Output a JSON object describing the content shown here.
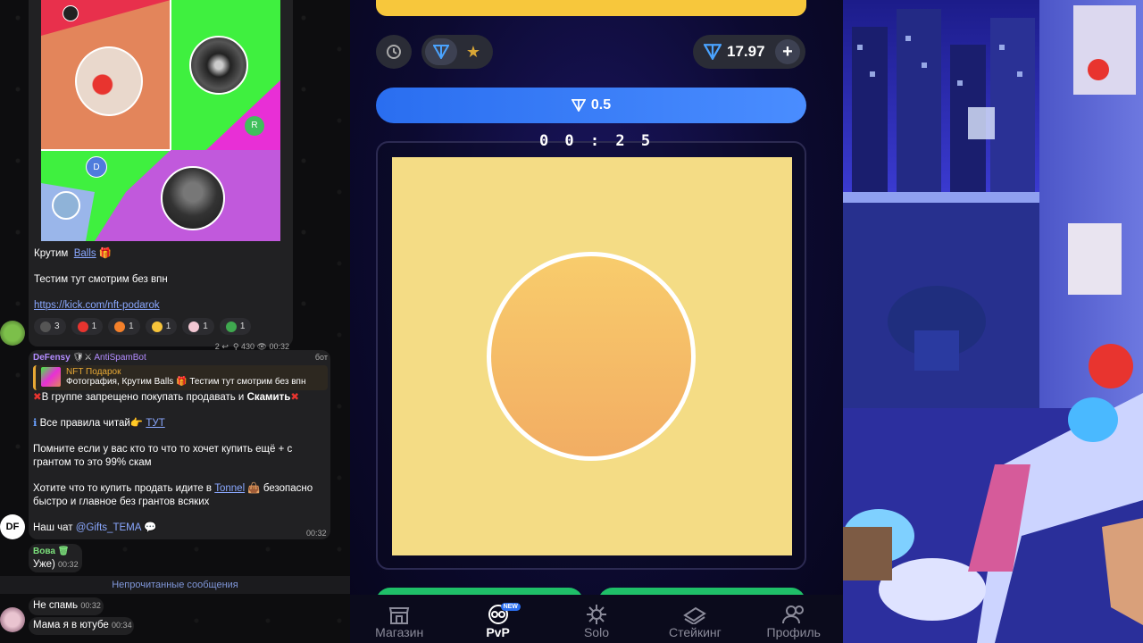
{
  "chat": {
    "post": {
      "collage_badges": [
        "R",
        "D"
      ],
      "line1": "Крутим",
      "line1_link": "Balls",
      "line2": "Тестим тут смотрим без впн",
      "url": "https://kick.com/nft-podarok",
      "reactions": [
        {
          "icon": "user-stack-icon",
          "count": "3"
        },
        {
          "icon": "heart-gift-icon",
          "count": "1"
        },
        {
          "icon": "fire-icon",
          "count": "1"
        },
        {
          "icon": "heart-eyes-icon",
          "count": "1"
        },
        {
          "icon": "gift-pink-icon",
          "count": "1"
        },
        {
          "icon": "plant-gift-icon",
          "count": "1"
        }
      ],
      "replies": "2",
      "views": "430",
      "time": "00:32"
    },
    "bot_message": {
      "author": "DeFensy",
      "author2": "AntiSpamBot",
      "bot_tag": "бот",
      "quote_title": "NFT Подарок",
      "quote_text": "Фотография, Крутим Balls",
      "quote_text2": "Тестим тут смотрим без впн",
      "rule_a": "В группе запрещено покупать продавать и",
      "rule_a_bold": "Скамить",
      "rule_b": "Все правила читай",
      "rule_b_link": "ТУТ",
      "para1": "Помните если у вас кто то что то хочет купить ещё + с грантом то это 99% скам",
      "para2_a": "Хотите что то купить продать идите в",
      "para2_link": "Tonnel",
      "para2_b": "безопасно быстро и главное без грантов всяких",
      "para3": "Наш чат",
      "para3_link": "@Gifts_TEMA",
      "time": "00:32",
      "avatar_text": "DF"
    },
    "vova": {
      "name": "Вова",
      "text": "Уже)",
      "time": "00:32"
    },
    "unread_label": "Непрочитанные сообщения",
    "msg1": {
      "text": "Не спамь",
      "time": "00:32"
    },
    "msg2": {
      "text": "Мама я в ютубе",
      "time": "00:34"
    }
  },
  "game": {
    "balance": "17.97",
    "bet": "0.5",
    "timer": "0 0 : 2 5",
    "tabs": [
      {
        "label": "Магазин",
        "icon": "shop-icon"
      },
      {
        "label": "PvP",
        "icon": "pvp-icon",
        "badge": "NEW"
      },
      {
        "label": "Solo",
        "icon": "gear-icon"
      },
      {
        "label": "Стейкинг",
        "icon": "staking-icon"
      },
      {
        "label": "Профиль",
        "icon": "profile-icon"
      }
    ],
    "colors": {
      "accent": "#2a6ef0",
      "field": "#f4dc85",
      "ball": "#f2ad63",
      "green": "#1fbf68"
    }
  }
}
